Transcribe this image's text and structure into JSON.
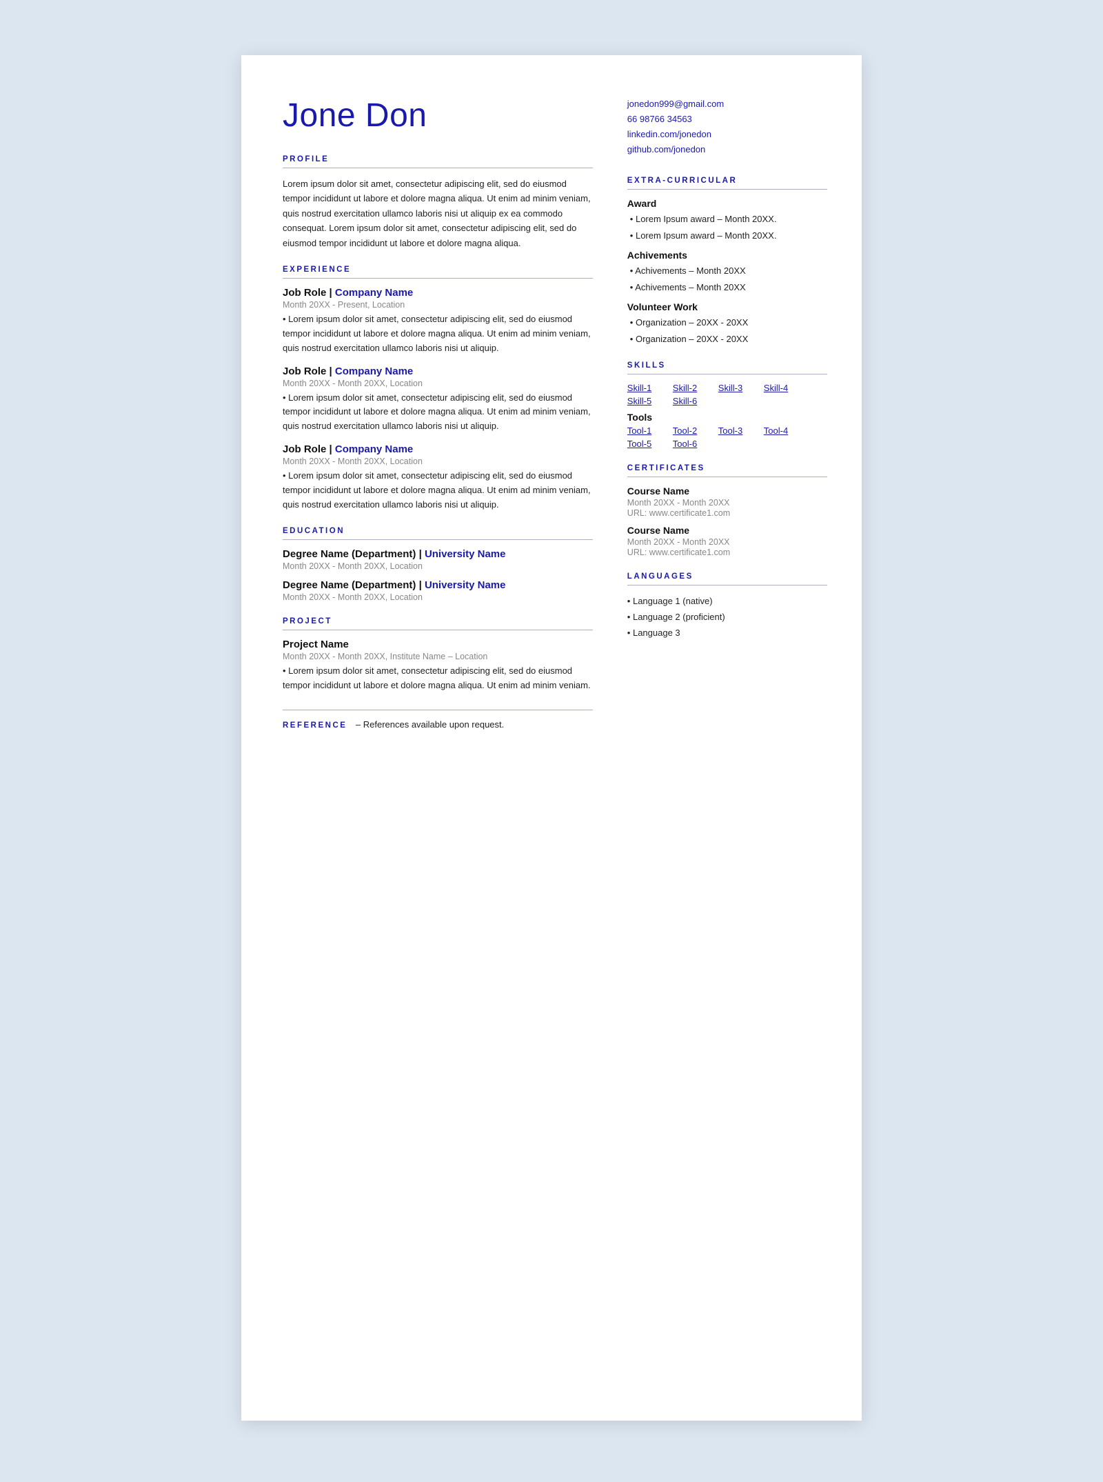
{
  "resume": {
    "name": "Jone Don",
    "contact": {
      "email": "jonedon999@gmail.com",
      "phone": "66 98766 34563",
      "linkedin": "linkedin.com/jonedon",
      "github": "github.com/jonedon"
    },
    "profile": {
      "section_title": "PROFILE",
      "text": "Lorem ipsum dolor sit amet, consectetur adipiscing elit, sed do eiusmod tempor incididunt ut labore et dolore magna aliqua. Ut enim ad minim veniam, quis nostrud exercitation ullamco laboris nisi ut aliquip ex ea commodo consequat. Lorem ipsum dolor sit amet, consectetur adipiscing elit, sed do eiusmod tempor incididunt ut labore et dolore magna aliqua."
    },
    "experience": {
      "section_title": "EXPERIENCE",
      "jobs": [
        {
          "role": "Job Role",
          "company": "Company Name",
          "date": "Month 20XX - Present, Location",
          "desc": "• Lorem ipsum dolor sit amet, consectetur adipiscing elit, sed do eiusmod tempor incididunt ut labore et dolore magna aliqua. Ut enim ad minim veniam, quis nostrud exercitation ullamco laboris nisi ut aliquip."
        },
        {
          "role": "Job Role",
          "company": "Company Name",
          "date": "Month 20XX - Month 20XX, Location",
          "desc": "• Lorem ipsum dolor sit amet, consectetur adipiscing elit, sed do eiusmod tempor incididunt ut labore et dolore magna aliqua. Ut enim ad minim veniam, quis nostrud exercitation ullamco laboris nisi ut aliquip."
        },
        {
          "role": "Job Role",
          "company": "Company Name",
          "date": "Month 20XX - Month 20XX, Location",
          "desc": "• Lorem ipsum dolor sit amet, consectetur adipiscing elit, sed do eiusmod tempor incididunt ut labore et dolore magna aliqua. Ut enim ad minim veniam, quis nostrud exercitation ullamco laboris nisi ut aliquip."
        }
      ]
    },
    "education": {
      "section_title": "EDUCATION",
      "degrees": [
        {
          "degree": "Degree Name (Department)",
          "university": "University Name",
          "date": "Month 20XX - Month 20XX, Location"
        },
        {
          "degree": "Degree Name (Department)",
          "university": "University Name",
          "date": "Month 20XX - Month 20XX, Location"
        }
      ]
    },
    "project": {
      "section_title": "PROJECT",
      "name": "Project Name",
      "date": "Month 20XX - Month 20XX, Institute Name – Location",
      "desc": "• Lorem ipsum dolor sit amet, consectetur adipiscing elit, sed do eiusmod tempor incididunt ut labore et dolore magna aliqua. Ut enim ad minim veniam."
    },
    "reference": {
      "label": "REFERENCE",
      "text": "– References available upon request."
    },
    "extra_curricular": {
      "section_title": "EXTRA-CURRICULAR",
      "award_title": "Award",
      "awards": [
        "• Lorem Ipsum award – Month 20XX.",
        "• Lorem Ipsum award – Month 20XX."
      ],
      "achievements_title": "Achivements",
      "achievements": [
        "• Achivements – Month 20XX",
        "• Achivements – Month 20XX"
      ],
      "volunteer_title": "Volunteer Work",
      "volunteer": [
        "• Organization – 20XX - 20XX",
        "• Organization – 20XX - 20XX"
      ]
    },
    "skills": {
      "section_title": "SKILLS",
      "skills": [
        "Skill-1",
        "Skill-2",
        "Skill-3",
        "Skill-4",
        "Skill-5",
        "Skill-6"
      ],
      "tools_label": "Tools",
      "tools": [
        "Tool-1",
        "Tool-2",
        "Tool-3",
        "Tool-4",
        "Tool-5",
        "Tool-6"
      ]
    },
    "certificates": {
      "section_title": "CERTIFICATES",
      "certs": [
        {
          "course": "Course Name",
          "date": "Month 20XX - Month 20XX",
          "url": "URL: www.certificate1.com"
        },
        {
          "course": "Course Name",
          "date": "Month 20XX - Month 20XX",
          "url": "URL: www.certificate1.com"
        }
      ]
    },
    "languages": {
      "section_title": "LANGUAGES",
      "langs": [
        "• Language 1 (native)",
        "• Language 2 (proficient)",
        "• Language 3"
      ]
    }
  }
}
